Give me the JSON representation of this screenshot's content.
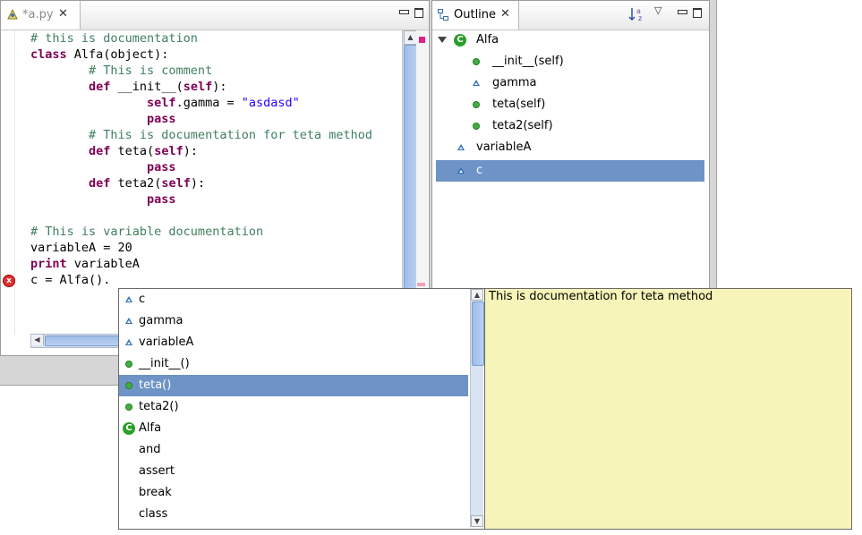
{
  "editor": {
    "tab_title": "*a.py",
    "close_glyph": "✕",
    "code": {
      "l1": "# this is documentation",
      "l2a": "class",
      "l2b": " Alfa(object):",
      "l3": "        # This is comment",
      "l4a": "        ",
      "l4b": "def",
      "l4c": " __init__(",
      "l4d": "self",
      "l4e": "):",
      "l5a": "                ",
      "l5b": "self",
      "l5c": ".gamma = ",
      "l5d": "\"asdasd\"",
      "l6a": "                ",
      "l6b": "pass",
      "l7": "        # This is documentation for teta method",
      "l8a": "        ",
      "l8b": "def",
      "l8c": " teta(",
      "l8d": "self",
      "l8e": "):",
      "l9a": "                ",
      "l9b": "pass",
      "l10a": "        ",
      "l10b": "def",
      "l10c": " teta2(",
      "l10d": "self",
      "l10e": "):",
      "l11a": "                ",
      "l11b": "pass",
      "l13": "# This is variable documentation",
      "l14": "variableA = 20",
      "l15a": "print",
      "l15b": " variableA",
      "l16": "c = Alfa()."
    },
    "error_glyph": "x",
    "scroll_up": "▲",
    "scroll_left": "◀",
    "ruler_glyph": "≡"
  },
  "outline": {
    "tab_title": "Outline",
    "close_glyph": "✕",
    "sort_glyph": "↓a z",
    "menu_glyph": "▽",
    "class_glyph": "C",
    "items": [
      {
        "label": "Alfa",
        "kind": "class"
      },
      {
        "label": "__init__(self)",
        "kind": "method"
      },
      {
        "label": "gamma",
        "kind": "attribute"
      },
      {
        "label": "teta(self)",
        "kind": "method"
      },
      {
        "label": "teta2(self)",
        "kind": "method"
      },
      {
        "label": "variableA",
        "kind": "attribute"
      },
      {
        "label": "c",
        "kind": "attribute",
        "selected": true
      }
    ]
  },
  "completion": {
    "items": [
      {
        "label": "c",
        "kind": "attribute"
      },
      {
        "label": "gamma",
        "kind": "attribute"
      },
      {
        "label": "variableA",
        "kind": "attribute"
      },
      {
        "label": "__init__()",
        "kind": "method"
      },
      {
        "label": "teta()",
        "kind": "method",
        "selected": true
      },
      {
        "label": "teta2()",
        "kind": "method"
      },
      {
        "label": "Alfa",
        "kind": "class"
      },
      {
        "label": "and",
        "kind": "keyword"
      },
      {
        "label": "assert",
        "kind": "keyword"
      },
      {
        "label": "break",
        "kind": "keyword"
      },
      {
        "label": "class",
        "kind": "keyword"
      }
    ],
    "scroll_up": "▲",
    "scroll_down": "▼",
    "class_glyph": "C"
  },
  "doc_popup": {
    "text": "This is documentation for teta method"
  },
  "colors": {
    "comment": "#3f7f5f",
    "keyword": "#7f0055",
    "string": "#2a00ff",
    "selection": "#6e93c6",
    "doc_background": "#f6f4b8"
  }
}
